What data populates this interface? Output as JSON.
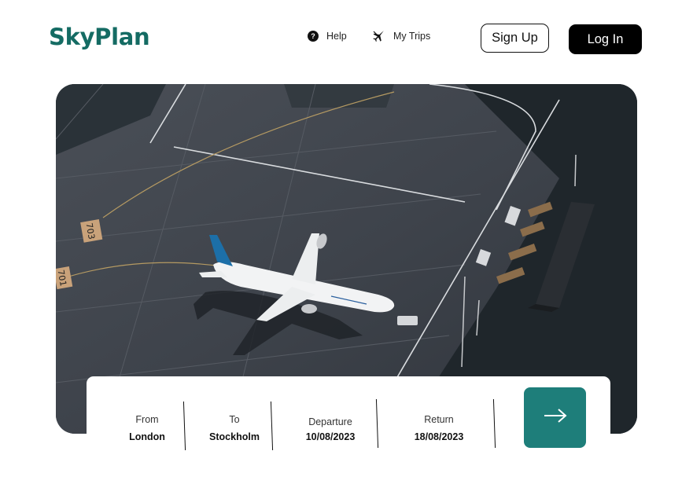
{
  "brand": {
    "name": "SkyPlan",
    "color": "#146b63"
  },
  "nav": {
    "help": {
      "label": "Help",
      "icon": "question-circle-icon"
    },
    "trips": {
      "label": "My Trips",
      "icon": "airplane-icon"
    }
  },
  "auth": {
    "signup_label": "Sign Up",
    "login_label": "Log In"
  },
  "hero": {
    "image": "aerial view of airplane parked on airport apron",
    "marking_1": "703",
    "marking_2": "701"
  },
  "search": {
    "from": {
      "label": "From",
      "value": "London"
    },
    "to": {
      "label": "To",
      "value": "Stockholm"
    },
    "departure": {
      "label": "Departure",
      "value": "10/08/2023"
    },
    "return": {
      "label": "Return",
      "value": "18/08/2023"
    },
    "submit_icon": "arrow-right-icon",
    "submit_color": "#1e7e7a"
  }
}
